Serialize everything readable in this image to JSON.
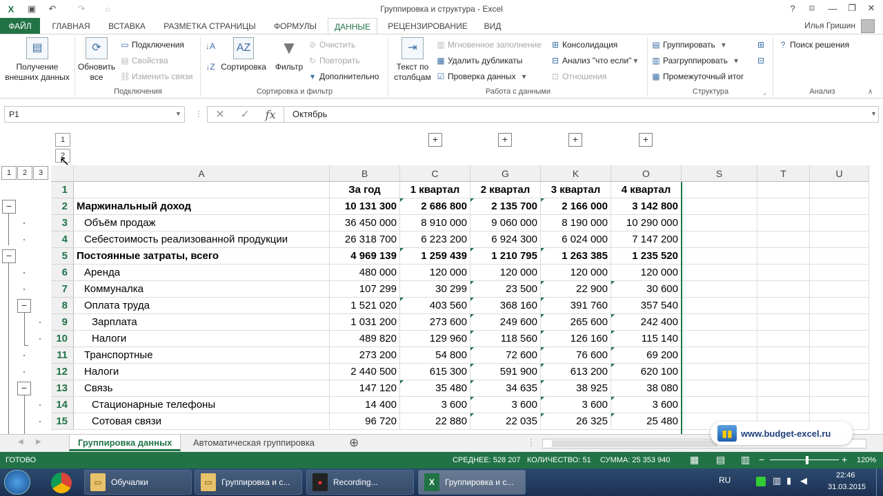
{
  "window": {
    "title": "Группировка и структура - Excel"
  },
  "title_controls": {
    "help": "?",
    "minimize": "—",
    "restore": "❐",
    "close": "✕"
  },
  "tabs": [
    {
      "label": "ФАЙЛ"
    },
    {
      "label": "ГЛАВНАЯ"
    },
    {
      "label": "ВСТАВКА"
    },
    {
      "label": "РАЗМЕТКА СТРАНИЦЫ"
    },
    {
      "label": "ФОРМУЛЫ"
    },
    {
      "label": "ДАННЫЕ"
    },
    {
      "label": "РЕЦЕНЗИРОВАНИЕ"
    },
    {
      "label": "ВИД"
    }
  ],
  "user": {
    "name": "Илья Гришин"
  },
  "ribbon": {
    "get_external": "Получение внешних данных",
    "refresh_all": "Обновить все",
    "connections": "Подключения",
    "properties": "Свойства",
    "edit_links": "Изменить связи",
    "group_connections": "Подключения",
    "sort": "Сортировка",
    "filter": "Фильтр",
    "clear": "Очистить",
    "reapply": "Повторить",
    "advanced": "Дополнительно",
    "group_sort": "Сортировка и фильтр",
    "text_to_columns": "Текст по столбцам",
    "flash_fill": "Мгновенное заполнение",
    "remove_duplicates": "Удалить дубликаты",
    "data_validation": "Проверка данных",
    "consolidate": "Консолидация",
    "what_if": "Анализ \"что если\"",
    "relationships": "Отношения",
    "group_data_tools": "Работа с данными",
    "group_btn": "Группировать",
    "ungroup_btn": "Разгруппировать",
    "subtotal": "Промежуточный итог",
    "group_outline": "Структура",
    "solver": "Поиск решения",
    "group_analysis": "Анализ"
  },
  "formula_bar": {
    "name_box": "P1",
    "value": "Октябрь",
    "fx": "fx"
  },
  "outline": {
    "row_levels": [
      "1",
      "2",
      "3"
    ],
    "col_levels": [
      "1",
      "2"
    ],
    "plus": "+",
    "minus": "−"
  },
  "columns": [
    "A",
    "B",
    "C",
    "G",
    "K",
    "O",
    "S",
    "T",
    "U"
  ],
  "rows": [
    {
      "n": "1",
      "a": "",
      "vals": [
        "За год",
        "1 квартал",
        "2 квартал",
        "3 квартал",
        "4 квартал"
      ],
      "bold": true,
      "indent": 0,
      "center": true
    },
    {
      "n": "2",
      "a": "Маржинальный доход",
      "vals": [
        "10 131 300",
        "2 686 800",
        "2 135 700",
        "2 166 000",
        "3 142 800"
      ],
      "bold": true,
      "indent": 0
    },
    {
      "n": "3",
      "a": "Объём продаж",
      "vals": [
        "36 450 000",
        "8 910 000",
        "9 060 000",
        "8 190 000",
        "10 290 000"
      ],
      "bold": false,
      "indent": 1
    },
    {
      "n": "4",
      "a": "Себестоимость реализованной продукции",
      "vals": [
        "26 318 700",
        "6 223 200",
        "6 924 300",
        "6 024 000",
        "7 147 200"
      ],
      "bold": false,
      "indent": 1
    },
    {
      "n": "5",
      "a": "Постоянные затраты, всего",
      "vals": [
        "4 969 139",
        "1 259 439",
        "1 210 795",
        "1 263 385",
        "1 235 520"
      ],
      "bold": true,
      "indent": 0
    },
    {
      "n": "6",
      "a": "Аренда",
      "vals": [
        "480 000",
        "120 000",
        "120 000",
        "120 000",
        "120 000"
      ],
      "bold": false,
      "indent": 1
    },
    {
      "n": "7",
      "a": "Коммуналка",
      "vals": [
        "107 299",
        "30 299",
        "23 500",
        "22 900",
        "30 600"
      ],
      "bold": false,
      "indent": 1
    },
    {
      "n": "8",
      "a": "Оплата труда",
      "vals": [
        "1 521 020",
        "403 560",
        "368 160",
        "391 760",
        "357 540"
      ],
      "bold": false,
      "indent": 1
    },
    {
      "n": "9",
      "a": "Зарплата",
      "vals": [
        "1 031 200",
        "273 600",
        "249 600",
        "265 600",
        "242 400"
      ],
      "bold": false,
      "indent": 2
    },
    {
      "n": "10",
      "a": "Налоги",
      "vals": [
        "489 820",
        "129 960",
        "118 560",
        "126 160",
        "115 140"
      ],
      "bold": false,
      "indent": 2
    },
    {
      "n": "11",
      "a": "Транспортные",
      "vals": [
        "273 200",
        "54 800",
        "72 600",
        "76 600",
        "69 200"
      ],
      "bold": false,
      "indent": 1
    },
    {
      "n": "12",
      "a": "Налоги",
      "vals": [
        "2 440 500",
        "615 300",
        "591 900",
        "613 200",
        "620 100"
      ],
      "bold": false,
      "indent": 1
    },
    {
      "n": "13",
      "a": "Связь",
      "vals": [
        "147 120",
        "35 480",
        "34 635",
        "38 925",
        "38 080"
      ],
      "bold": false,
      "indent": 1
    },
    {
      "n": "14",
      "a": "Стационарные телефоны",
      "vals": [
        "14 400",
        "3 600",
        "3 600",
        "3 600",
        "3 600"
      ],
      "bold": false,
      "indent": 2
    },
    {
      "n": "15",
      "a": "Сотовая связи",
      "vals": [
        "96 720",
        "22 880",
        "22 035",
        "26 325",
        "25 480"
      ],
      "bold": false,
      "indent": 2
    }
  ],
  "sheets": {
    "active": "Группировка данных",
    "other": "Автоматическая группировка",
    "add": "⊕"
  },
  "status": {
    "ready": "ГОТОВО",
    "average": "СРЕДНЕЕ: 528 207",
    "count": "КОЛИЧЕСТВО: 51",
    "sum": "СУММА: 25 353 940",
    "zoom": "120%"
  },
  "watermark": {
    "text": "www.budget-excel.ru"
  },
  "taskbar": {
    "items": [
      {
        "label": "Обучалки"
      },
      {
        "label": "Группировка и с..."
      },
      {
        "label": "Recording..."
      },
      {
        "label": "Группировка и с..."
      }
    ],
    "lang": "RU",
    "time": "22:46",
    "date": "31.03.2015"
  },
  "colors": {
    "accent": "#217346",
    "taskbar": "#1c3152"
  }
}
